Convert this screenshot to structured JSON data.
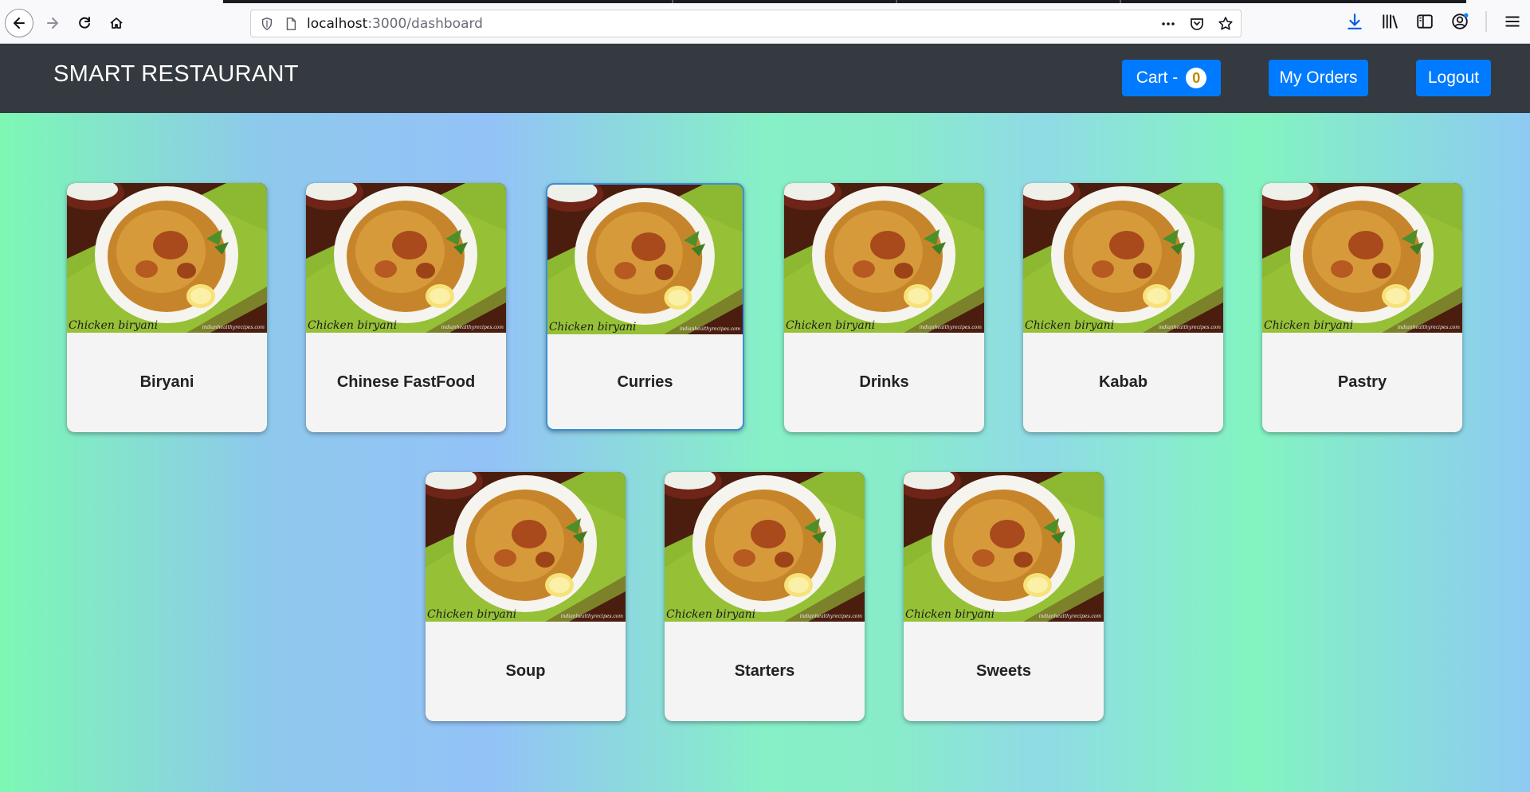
{
  "browser": {
    "url_host": "localhost",
    "url_path": ":3000/dashboard"
  },
  "header": {
    "brand": "SMART RESTAURANT",
    "cart_label": "Cart -",
    "cart_count": "0",
    "my_orders_label": "My Orders",
    "logout_label": "Logout"
  },
  "categories": [
    {
      "name": "Biryani",
      "image_caption": "Chicken biryani",
      "image_credit": "indianhealthyrecipes.com"
    },
    {
      "name": "Chinese FastFood",
      "image_caption": "Chicken biryani",
      "image_credit": "indianhealthyrecipes.com"
    },
    {
      "name": "Curries",
      "image_caption": "Chicken biryani",
      "image_credit": "indianhealthyrecipes.com"
    },
    {
      "name": "Drinks",
      "image_caption": "Chicken biryani",
      "image_credit": "indianhealthyrecipes.com"
    },
    {
      "name": "Kabab",
      "image_caption": "Chicken biryani",
      "image_credit": "indianhealthyrecipes.com"
    },
    {
      "name": "Pastry",
      "image_caption": "Chicken biryani",
      "image_credit": "indianhealthyrecipes.com"
    },
    {
      "name": "Soup",
      "image_caption": "Chicken biryani",
      "image_credit": "indianhealthyrecipes.com"
    },
    {
      "name": "Starters",
      "image_caption": "Chicken biryani",
      "image_credit": "indianhealthyrecipes.com"
    },
    {
      "name": "Sweets",
      "image_caption": "Chicken biryani",
      "image_credit": "indianhealthyrecipes.com"
    }
  ],
  "icons": {
    "back": "back-arrow-icon",
    "forward": "forward-arrow-icon",
    "reload": "reload-icon",
    "home": "home-icon",
    "shield": "tracking-shield-icon",
    "page": "page-icon",
    "more": "more-dots-icon",
    "pocket": "pocket-icon",
    "bookmark": "star-icon",
    "download": "download-icon",
    "library": "library-icon",
    "sidebar": "sidebar-icon",
    "account": "account-icon",
    "menu": "hamburger-menu-icon"
  },
  "colors": {
    "header_bg": "#343a40",
    "button_blue": "#007bff",
    "card_bg": "#f4f4f4",
    "active_border": "#3a8fd8"
  }
}
